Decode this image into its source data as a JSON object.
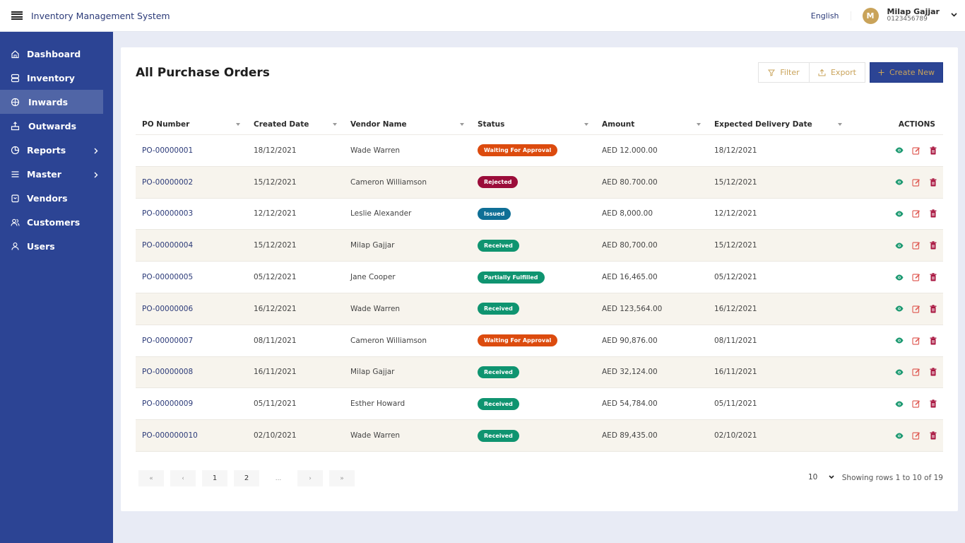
{
  "header": {
    "app_title": "Inventory Management System",
    "language": "English",
    "user": {
      "initial": "M",
      "name": "Milap Gajjar",
      "phone": "0123456789"
    }
  },
  "sidebar": {
    "items": [
      {
        "label": "Dashboard",
        "icon": "home-icon",
        "active": false,
        "has_submenu": false
      },
      {
        "label": "Inventory",
        "icon": "server-icon",
        "active": false,
        "has_submenu": false
      },
      {
        "label": "Inwards",
        "icon": "box-in-icon",
        "active": true,
        "has_submenu": false
      },
      {
        "label": "Outwards",
        "icon": "box-out-icon",
        "active": false,
        "has_submenu": false
      },
      {
        "label": "Reports",
        "icon": "pie-chart-icon",
        "active": false,
        "has_submenu": true
      },
      {
        "label": "Master",
        "icon": "menu-icon",
        "active": false,
        "has_submenu": true
      },
      {
        "label": "Vendors",
        "icon": "store-icon",
        "active": false,
        "has_submenu": false
      },
      {
        "label": "Customers",
        "icon": "users-icon",
        "active": false,
        "has_submenu": false
      },
      {
        "label": "Users",
        "icon": "user-icon",
        "active": false,
        "has_submenu": false
      }
    ]
  },
  "main": {
    "title": "All Purchase Orders",
    "toolbar": {
      "filter_label": "Filter",
      "export_label": "Export",
      "create_label": "Create New"
    },
    "table": {
      "columns": [
        "PO Number",
        "Created Date",
        "Vendor Name",
        "Status",
        "Amount",
        "Expected Delivery Date",
        "ACTIONS"
      ],
      "rows": [
        {
          "po": "PO-00000001",
          "created": "18/12/2021",
          "vendor": "Wade Warren",
          "status": "Waiting For Approval",
          "amount": "AED 12.000.00",
          "delivery": "18/12/2021"
        },
        {
          "po": "PO-00000002",
          "created": "15/12/2021",
          "vendor": "Cameron Williamson",
          "status": "Rejected",
          "amount": "AED 80.700.00",
          "delivery": "15/12/2021"
        },
        {
          "po": "PO-00000003",
          "created": "12/12/2021",
          "vendor": "Leslie Alexander",
          "status": "Issued",
          "amount": "AED 8,000.00",
          "delivery": "12/12/2021"
        },
        {
          "po": "PO-00000004",
          "created": "15/12/2021",
          "vendor": "Milap Gajjar",
          "status": "Received",
          "amount": "AED 80,700.00",
          "delivery": "15/12/2021"
        },
        {
          "po": "PO-00000005",
          "created": "05/12/2021",
          "vendor": "Jane Cooper",
          "status": "Partially Fulfilled",
          "amount": "AED 16,465.00",
          "delivery": "05/12/2021"
        },
        {
          "po": "PO-00000006",
          "created": "16/12/2021",
          "vendor": "Wade Warren",
          "status": "Received",
          "amount": "AED 123,564.00",
          "delivery": "16/12/2021"
        },
        {
          "po": "PO-00000007",
          "created": "08/11/2021",
          "vendor": "Cameron Williamson",
          "status": "Waiting For Approval",
          "amount": "AED 90,876.00",
          "delivery": "08/11/2021"
        },
        {
          "po": "PO-00000008",
          "created": "16/11/2021",
          "vendor": "Milap Gajjar",
          "status": "Received",
          "amount": "AED 32,124.00",
          "delivery": "16/11/2021"
        },
        {
          "po": "PO-00000009",
          "created": "05/11/2021",
          "vendor": "Esther Howard",
          "status": "Received",
          "amount": "AED 54,784.00",
          "delivery": "05/11/2021"
        },
        {
          "po": "PO-000000010",
          "created": "02/10/2021",
          "vendor": "Wade Warren",
          "status": "Received",
          "amount": "AED 89,435.00",
          "delivery": "02/10/2021"
        }
      ]
    },
    "status_colors": {
      "Waiting For Approval": "#dc4b0e",
      "Rejected": "#9b0d3a",
      "Issued": "#0f6f96",
      "Received": "#0f9470",
      "Partially Fulfilled": "#0f9470"
    },
    "pagination": {
      "first": "«",
      "prev": "‹",
      "pages": [
        "1",
        "2"
      ],
      "ellipsis": "...",
      "next": "›",
      "last": "»",
      "page_size": "10",
      "rows_info": "Showing rows 1 to 10 of 19"
    }
  },
  "colors": {
    "primary": "#2c4494",
    "accent": "#c9a35a",
    "row_alt": "#f7f4ed",
    "background": "#e8ebf5"
  }
}
